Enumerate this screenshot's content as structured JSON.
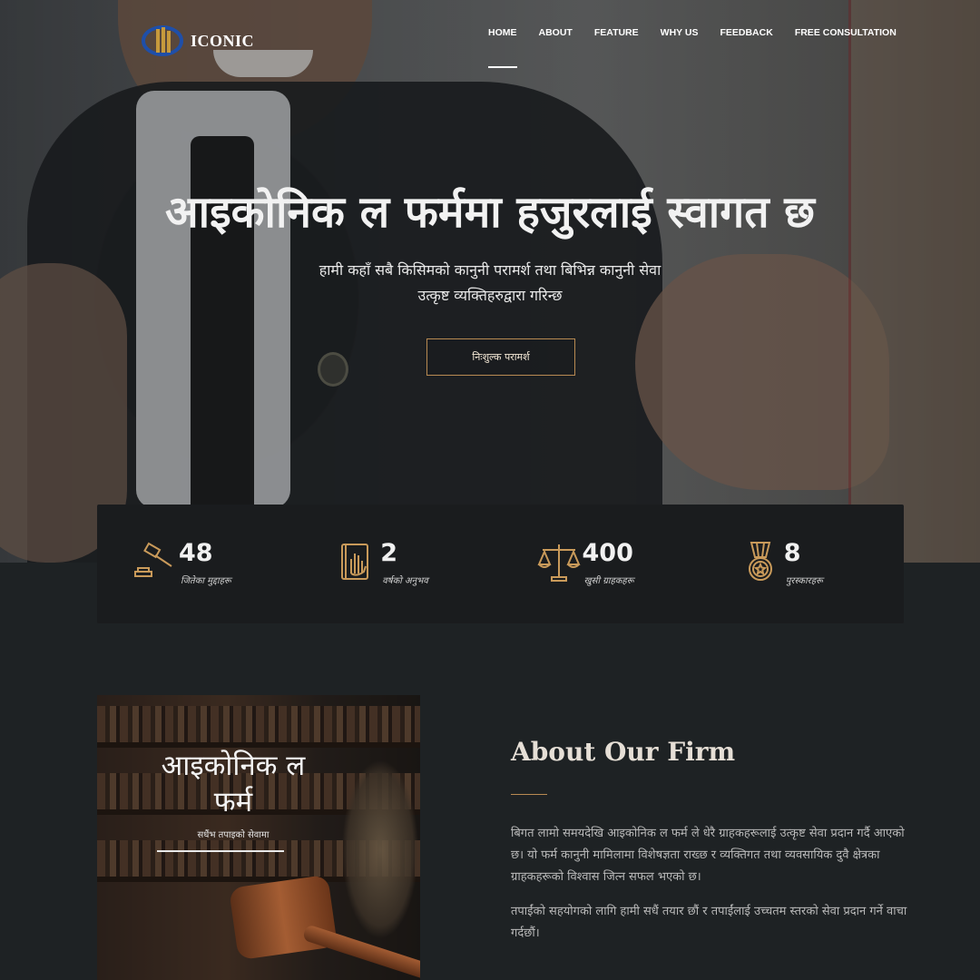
{
  "brand": {
    "name": "ICONIC",
    "accent": "#b88a52",
    "logo_color": "#1f4fa8"
  },
  "nav": {
    "items": [
      "HOME",
      "ABOUT",
      "FEATURE",
      "WHY US",
      "FEEDBACK",
      "FREE CONSULTATION"
    ],
    "active": "HOME"
  },
  "hero": {
    "title": "आइकोनिक ल फर्ममा हजुरलाई स्वागत छ",
    "subtitle_line1": "हामी कहाँ सबै किसिमको कानुनी परामर्श तथा बिभिन्न कानुनी सेवा",
    "subtitle_line2": "उत्कृष्ट व्यक्तिहरुद्वारा गरिन्छ",
    "cta_label": "निःशुल्क परामर्श"
  },
  "stats": [
    {
      "icon": "gavel-icon",
      "value": "48",
      "label": "जितेका मुद्दाहरू"
    },
    {
      "icon": "book-hand-icon",
      "value": "2",
      "label": "वर्षको अनुभव"
    },
    {
      "icon": "scales-icon",
      "value": "400",
      "label": "खुसी ग्राहकहरू"
    },
    {
      "icon": "medal-icon",
      "value": "8",
      "label": "पुरस्कारहरू"
    }
  ],
  "about": {
    "image_title_line1": "आइकोनिक ल",
    "image_title_line2": "फर्म",
    "image_tagline": "सधैंभ तपाइको सेवामा",
    "heading": "About Our Firm",
    "paragraph1": "बिगत लामो समयदेखि आइकोनिक ल फर्म ले धेरै ग्राहकहरूलाई उत्कृष्ट सेवा प्रदान गर्दै आएको छ। यो फर्म कानुनी मामिलामा विशेषज्ञता राख्छ र व्यक्तिगत तथा व्यवसायिक दुवै क्षेत्रका ग्राहकहरूको विश्वास जित्न सफल भएको छ।",
    "paragraph2": "तपाईंको सहयोगको लागि हामी सधैं तयार छौं र तपाईंलाई उच्चतम स्तरको सेवा प्रदान गर्ने वाचा गर्दछौं।"
  }
}
